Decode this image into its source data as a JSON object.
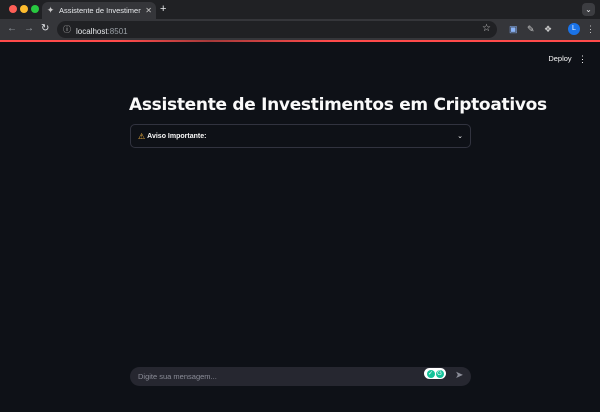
{
  "browser": {
    "tab_title": "Assistente de Investimentos",
    "tab_favicon": "streamlit-icon",
    "new_tab_label": "+",
    "url_host": "localhost",
    "url_port": ":8501",
    "profile_initial": "L"
  },
  "header": {
    "deploy_label": "Deploy"
  },
  "main": {
    "title": "Assistente de Investimentos em Criptoativos",
    "expander_label": "Aviso Importante:"
  },
  "chat": {
    "placeholder": "Digite sua mensagem..."
  },
  "colors": {
    "background": "#0e1117",
    "accent": "#ff4b4b",
    "warning": "#ffbd45",
    "input_bg": "#262730"
  }
}
